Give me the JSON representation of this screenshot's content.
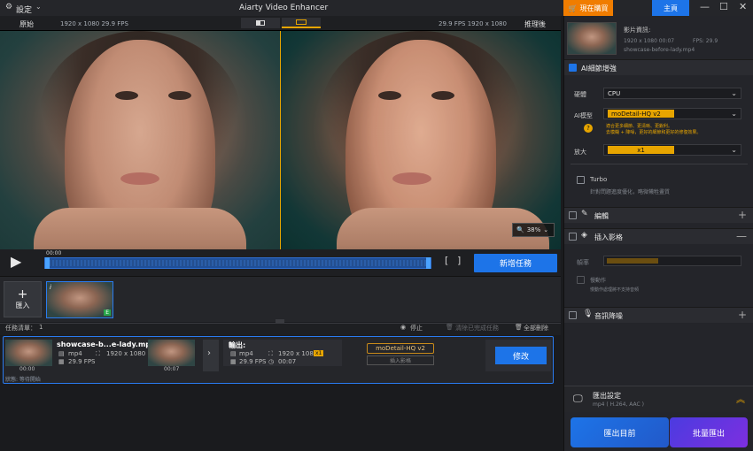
{
  "titlebar": {
    "settings_label": "設定",
    "app_title": "Aiarty Video Enhancer",
    "buy_now": "現在購買",
    "home": "主頁"
  },
  "preview": {
    "left_label": "原始",
    "left_info": "1920 x 1080  29.9 FPS",
    "right_info": "29.9 FPS  1920 x 1080",
    "right_label": "推理後",
    "zoom": "38%",
    "time": "00:00",
    "add_task": "新增任務"
  },
  "media": {
    "import_label": "匯入",
    "thumb_badge": "E",
    "thumb_info": "i"
  },
  "tasks": {
    "count_label": "任務清單：",
    "count_value": "1",
    "stop": "停止",
    "clear_done": "清除已完成任務",
    "delete_all": "全部刪除",
    "row": {
      "name": "showcase-b...e-lady.mp4",
      "format": "mp4",
      "resolution": "1920 x 1080",
      "fps": "29.9 FPS",
      "time_in": "00:00",
      "time_out": "00:07",
      "output_label": "輸出:",
      "out_format": "mp4",
      "out_resolution": "1920 x 1080",
      "scale_badge": "x1",
      "out_fps": "29.9 FPS",
      "out_duration": "00:07",
      "model": "moDetail-HQ  v2",
      "add_effect": "插入影格",
      "modify": "修改",
      "status": "狀態: 等待開始"
    }
  },
  "panel": {
    "video_info_label": "影片資訊:",
    "resolution": "1920 x 1080  00:07",
    "fps": "FPS: 29.9",
    "filename": "showcase-before-lady.mp4",
    "ai_section": "AI細節增強",
    "hardware_label": "硬體",
    "hardware_value": "CPU",
    "model_label": "AI模型",
    "model_value": "moDetail-HQ  v2",
    "model_desc1": "適合更多細節、更清晰、更銳利。",
    "model_desc2": "去模糊 + 降噪，更好的細節和更好的修復效果。",
    "scale_label": "放大",
    "scale_value": "x1",
    "turbo_label": "Turbo",
    "turbo_desc": "針對問題進度優化，略微犧牲畫質",
    "edit_section": "編輯",
    "frame_section": "插入影格",
    "frame_rate_label": "幀率",
    "frame_sub_label": "慢動作",
    "frame_sub_desc": "慢動作處理將不支持音頻",
    "audio_section": "音訊降噪",
    "export_title": "匯出設定",
    "export_detail": "mp4 ( H.264, AAC )",
    "export_button": "匯出目前",
    "batch_button": "批量匯出"
  },
  "colors": {
    "accent_blue": "#1d74e8",
    "accent_orange": "#f07d00",
    "model_chip": "#e7a500",
    "batch_purple": "#6d32e0"
  }
}
